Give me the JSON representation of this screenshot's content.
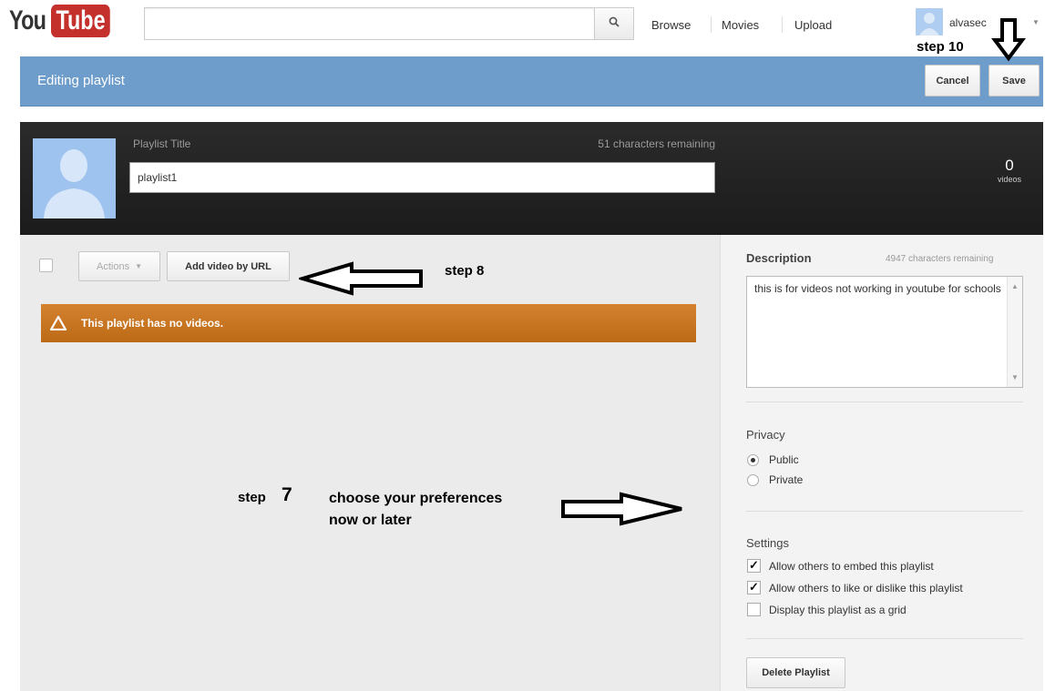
{
  "header": {
    "logo_you": "You",
    "logo_tube": "Tube",
    "search_placeholder": "",
    "nav": [
      "Browse",
      "Movies",
      "Upload"
    ],
    "username": "alvasec"
  },
  "editbar": {
    "title": "Editing playlist",
    "cancel_label": "Cancel",
    "save_label": "Save"
  },
  "playlist": {
    "title_label": "Playlist Title",
    "remaining": "51 characters remaining",
    "title_value": "playlist1",
    "video_count": "0",
    "video_count_label": "videos"
  },
  "list": {
    "actions_label": "Actions",
    "add_url_label": "Add video by URL",
    "notice": "This playlist has no videos."
  },
  "sidebar": {
    "description_label": "Description",
    "description_remaining": "4947 characters remaining",
    "description_value": "this is for videos not working in youtube for schools",
    "privacy_label": "Privacy",
    "privacy_options": [
      {
        "label": "Public",
        "selected": true
      },
      {
        "label": "Private",
        "selected": false
      }
    ],
    "settings_label": "Settings",
    "settings_options": [
      {
        "label": "Allow others to embed this playlist",
        "checked": true
      },
      {
        "label": "Allow others to like or dislike this playlist",
        "checked": true
      },
      {
        "label": "Display this playlist as a grid",
        "checked": false
      }
    ],
    "delete_label": "Delete Playlist"
  },
  "annotations": {
    "step10": "step 10",
    "step8": "step 8",
    "step7_word": "step",
    "step7_num": "7",
    "prefs_line1": "choose your preferences",
    "prefs_line2": "now or later"
  },
  "colors": {
    "editbar": "#6e9dcc",
    "notice": "#c8762a",
    "logo_red": "#c4302b"
  }
}
